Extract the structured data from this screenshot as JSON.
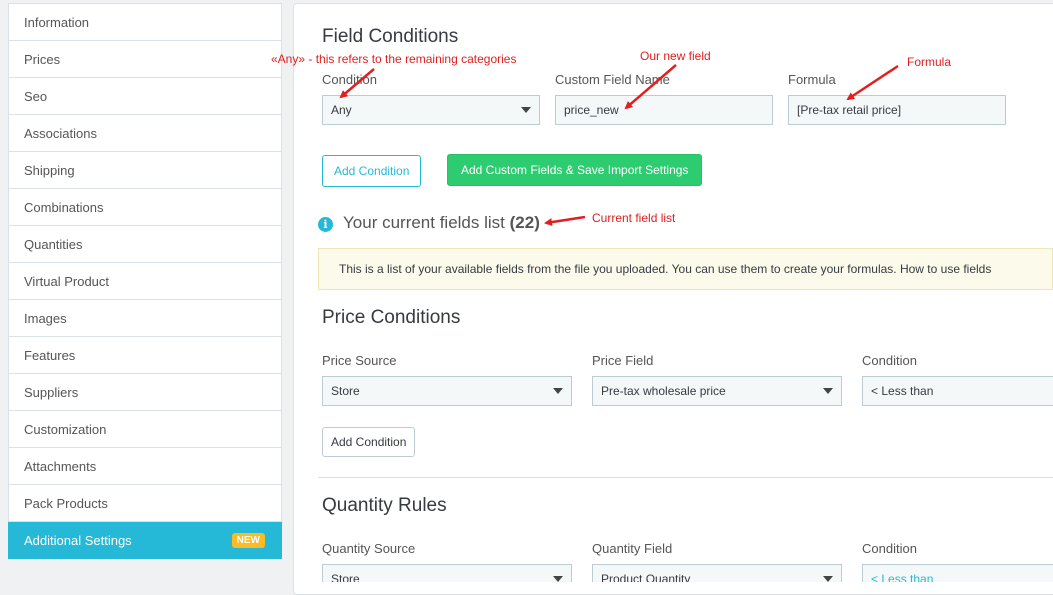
{
  "sidebar": {
    "items": [
      {
        "label": "Information"
      },
      {
        "label": "Prices"
      },
      {
        "label": "Seo"
      },
      {
        "label": "Associations"
      },
      {
        "label": "Shipping"
      },
      {
        "label": "Combinations"
      },
      {
        "label": "Quantities"
      },
      {
        "label": "Virtual Product"
      },
      {
        "label": "Images"
      },
      {
        "label": "Features"
      },
      {
        "label": "Suppliers"
      },
      {
        "label": "Customization"
      },
      {
        "label": "Attachments"
      },
      {
        "label": "Pack Products"
      },
      {
        "label": "Additional Settings",
        "badge": "NEW"
      }
    ]
  },
  "field_conditions": {
    "title": "Field Conditions",
    "condition_label": "Condition",
    "condition_value": "Any",
    "custom_field_label": "Custom Field Name",
    "custom_field_value": "price_new",
    "formula_label": "Formula",
    "formula_value": "[Pre-tax retail price]",
    "add_condition_label": "Add Condition",
    "save_label": "Add Custom Fields & Save Import Settings"
  },
  "fields_list": {
    "title": "Your current fields list",
    "count": "(22)",
    "notice": "This is a list of your available fields from the file you uploaded. You can use them to create your formulas. How to use fields"
  },
  "price_conditions": {
    "title": "Price Conditions",
    "source_label": "Price Source",
    "source_value": "Store",
    "field_label": "Price Field",
    "field_value": "Pre-tax wholesale price",
    "condition_label": "Condition",
    "condition_value": "< Less than",
    "add_condition_label": "Add Condition"
  },
  "quantity_rules": {
    "title": "Quantity Rules",
    "source_label": "Quantity Source",
    "source_value": "Store",
    "field_label": "Quantity Field",
    "field_value": "Product Quantity",
    "condition_label": "Condition",
    "condition_value": "< Less than"
  },
  "annotations": {
    "any_note": "«Any» - this refers to the remaining categories",
    "new_field_note": "Our new field",
    "formula_note": "Formula",
    "list_note": "Current field list"
  },
  "colors": {
    "accent": "#25b9d7",
    "save_button": "#2ecc71",
    "badge": "#fbbb22",
    "annotation": "#e02020"
  }
}
